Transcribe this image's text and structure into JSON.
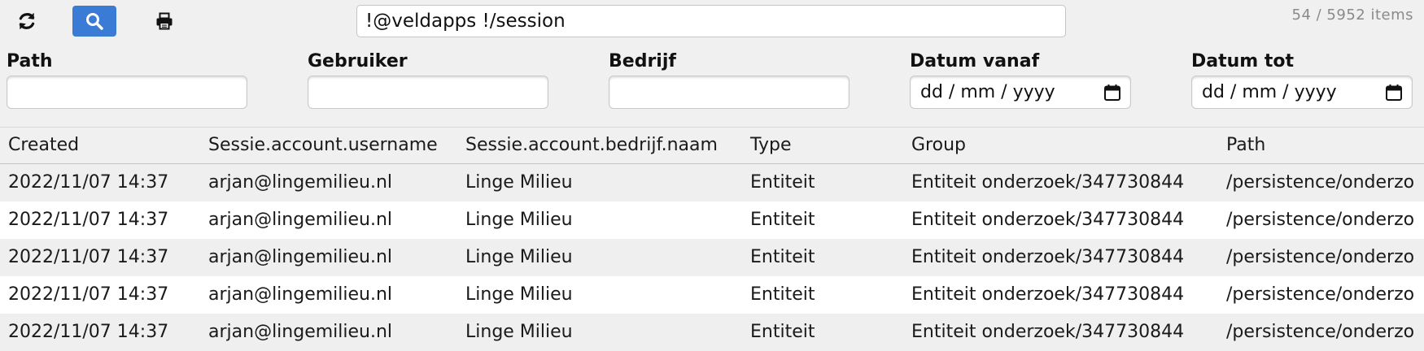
{
  "toolbar": {
    "query": "!@veldapps !/session",
    "item_count": "54 / 5952 items",
    "active_color": "#3a7bd5",
    "icons": [
      "refresh-icon",
      "search-icon",
      "print-icon"
    ]
  },
  "filters": {
    "path": {
      "label": "Path",
      "value": ""
    },
    "gebruiker": {
      "label": "Gebruiker",
      "value": ""
    },
    "bedrijf": {
      "label": "Bedrijf",
      "value": ""
    },
    "datum_vanaf": {
      "label": "Datum vanaf",
      "placeholder": "dd / mm / yyyy"
    },
    "datum_tot": {
      "label": "Datum tot",
      "placeholder": "dd / mm / yyyy"
    }
  },
  "table": {
    "columns": [
      "Created",
      "Sessie.account.username",
      "Sessie.account.bedrijf.naam",
      "Type",
      "Group",
      "Path"
    ],
    "rows": [
      [
        "2022/11/07 14:37",
        "arjan@lingemilieu.nl",
        "Linge Milieu",
        "Entiteit",
        "Entiteit onderzoek/347730844",
        "/persistence/onderzo"
      ],
      [
        "2022/11/07 14:37",
        "arjan@lingemilieu.nl",
        "Linge Milieu",
        "Entiteit",
        "Entiteit onderzoek/347730844",
        "/persistence/onderzo"
      ],
      [
        "2022/11/07 14:37",
        "arjan@lingemilieu.nl",
        "Linge Milieu",
        "Entiteit",
        "Entiteit onderzoek/347730844",
        "/persistence/onderzo"
      ],
      [
        "2022/11/07 14:37",
        "arjan@lingemilieu.nl",
        "Linge Milieu",
        "Entiteit",
        "Entiteit onderzoek/347730844",
        "/persistence/onderzo"
      ],
      [
        "2022/11/07 14:37",
        "arjan@lingemilieu.nl",
        "Linge Milieu",
        "Entiteit",
        "Entiteit onderzoek/347730844",
        "/persistence/onderzo"
      ]
    ]
  }
}
